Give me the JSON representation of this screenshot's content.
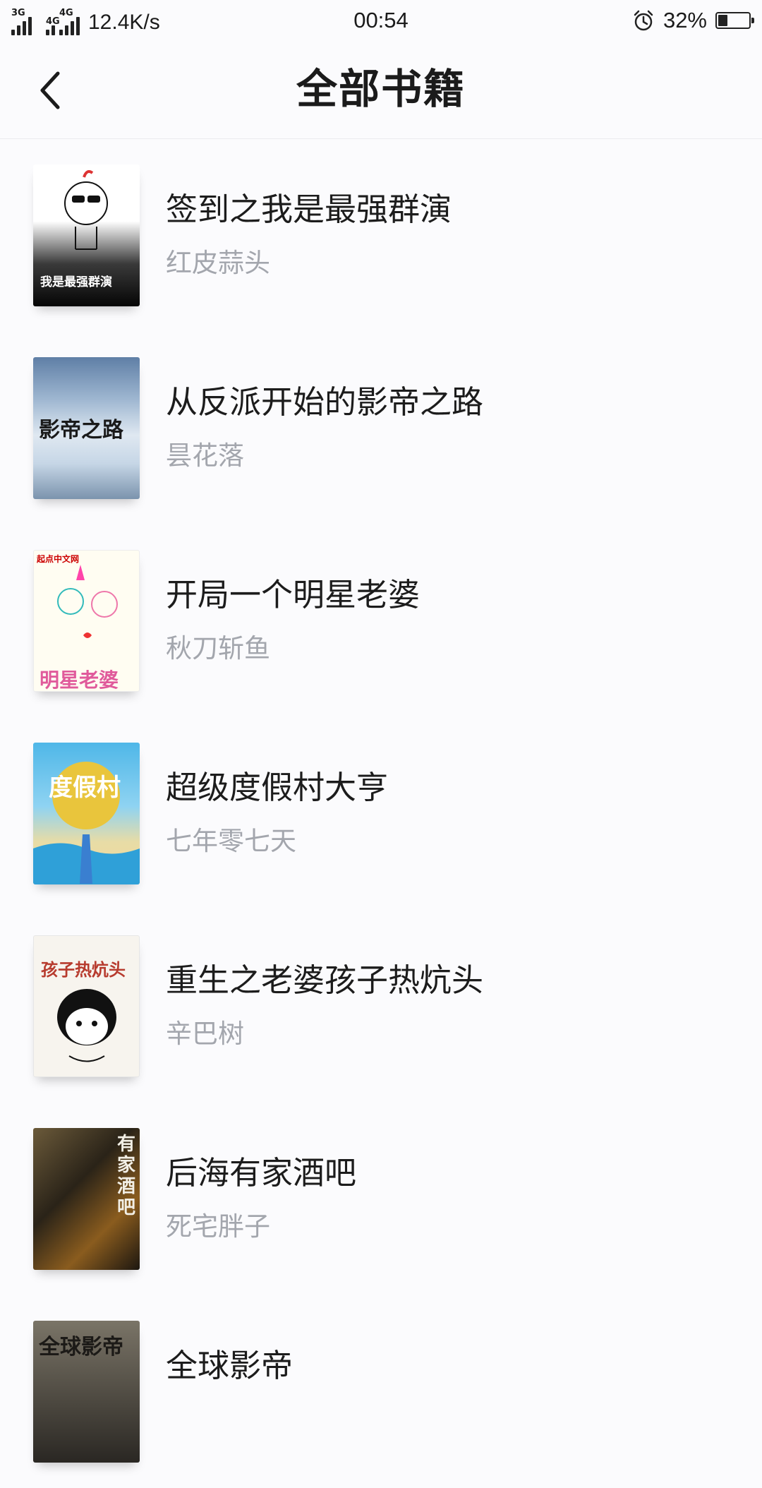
{
  "status_bar": {
    "sim1_label": "3G",
    "sim2_label": "4G",
    "sim2b_label": "4G",
    "network_speed": "12.4K/s",
    "time": "00:54",
    "battery_percent": "32%",
    "battery_level": 0.32,
    "icons": [
      "signal-icon",
      "alarm-icon",
      "battery-icon"
    ]
  },
  "header": {
    "back_icon": "chevron-left-icon",
    "title": "全部书籍"
  },
  "books": [
    {
      "title": "签到之我是最强群演",
      "author": "红皮蒜头",
      "cover_text": "我是最强群演"
    },
    {
      "title": "从反派开始的影帝之路",
      "author": "昙花落",
      "cover_text": "影帝之路"
    },
    {
      "title": "开局一个明星老婆",
      "author": "秋刀斩鱼",
      "cover_text": "明星老婆",
      "cover_badge": "起点中文网"
    },
    {
      "title": "超级度假村大亨",
      "author": "七年零七天",
      "cover_text": "度假村"
    },
    {
      "title": "重生之老婆孩子热炕头",
      "author": "辛巴树",
      "cover_text": "孩子热炕头"
    },
    {
      "title": "后海有家酒吧",
      "author": "死宅胖子",
      "cover_text": "有家酒吧"
    },
    {
      "title": "全球影帝",
      "author": "",
      "cover_text": "全球影帝"
    }
  ],
  "colors": {
    "background": "#fbfbfd",
    "title_text": "#1c1c1c",
    "author_text": "#a3a6ad",
    "divider": "#ececef"
  }
}
